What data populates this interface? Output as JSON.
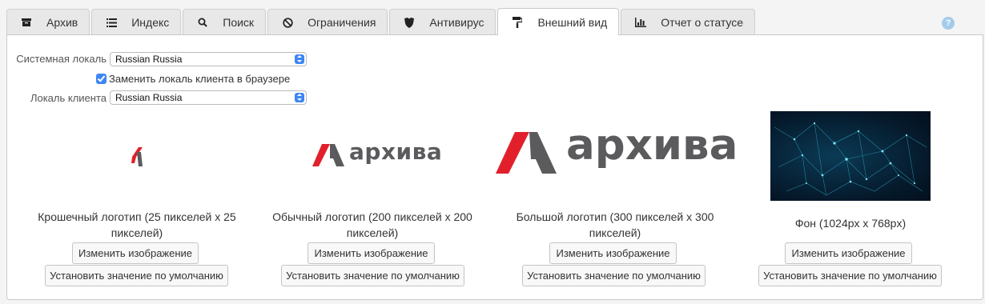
{
  "tabs": [
    {
      "label": "Архив",
      "icon": "archive-icon"
    },
    {
      "label": "Индекс",
      "icon": "list-icon"
    },
    {
      "label": "Поиск",
      "icon": "search-icon"
    },
    {
      "label": "Ограничения",
      "icon": "ban-icon"
    },
    {
      "label": "Антивирус",
      "icon": "shield-icon"
    },
    {
      "label": "Внешний вид",
      "icon": "paint-roller-icon",
      "active": true
    },
    {
      "label": "Отчет о статусе",
      "icon": "bar-chart-icon"
    }
  ],
  "help": {
    "glyph": "?"
  },
  "settings": {
    "system_locale_label": "Системная локаль",
    "system_locale_value": "Russian Russia",
    "override_label": "Заменить локаль клиента в браузере",
    "override_checked": true,
    "client_locale_label": "Локаль клиента",
    "client_locale_value": "Russian Russia"
  },
  "logo_text": "архива",
  "images": [
    {
      "caption_line1": "Крошечный логотип (25 пикселей x 25",
      "caption_line2": "пикселей)",
      "change_label": "Изменить изображение",
      "reset_label": "Установить значение по умолчанию"
    },
    {
      "caption_line1": "Обычный логотип (200 пикселей x 200",
      "caption_line2": "пикселей)",
      "change_label": "Изменить изображение",
      "reset_label": "Установить значение по умолчанию"
    },
    {
      "caption_line1": "Большой логотип (300 пикселей x 300",
      "caption_line2": "пикселей)",
      "change_label": "Изменить изображение",
      "reset_label": "Установить значение по умолчанию"
    },
    {
      "caption_line1": "Фон (1024px x 768px)",
      "caption_line2": "",
      "change_label": "Изменить изображение",
      "reset_label": "Установить значение по умолчанию"
    }
  ],
  "colors": {
    "brand_red": "#e2202c",
    "brand_grey": "#5b5b5d",
    "accent_blue": "#3d86f4"
  }
}
